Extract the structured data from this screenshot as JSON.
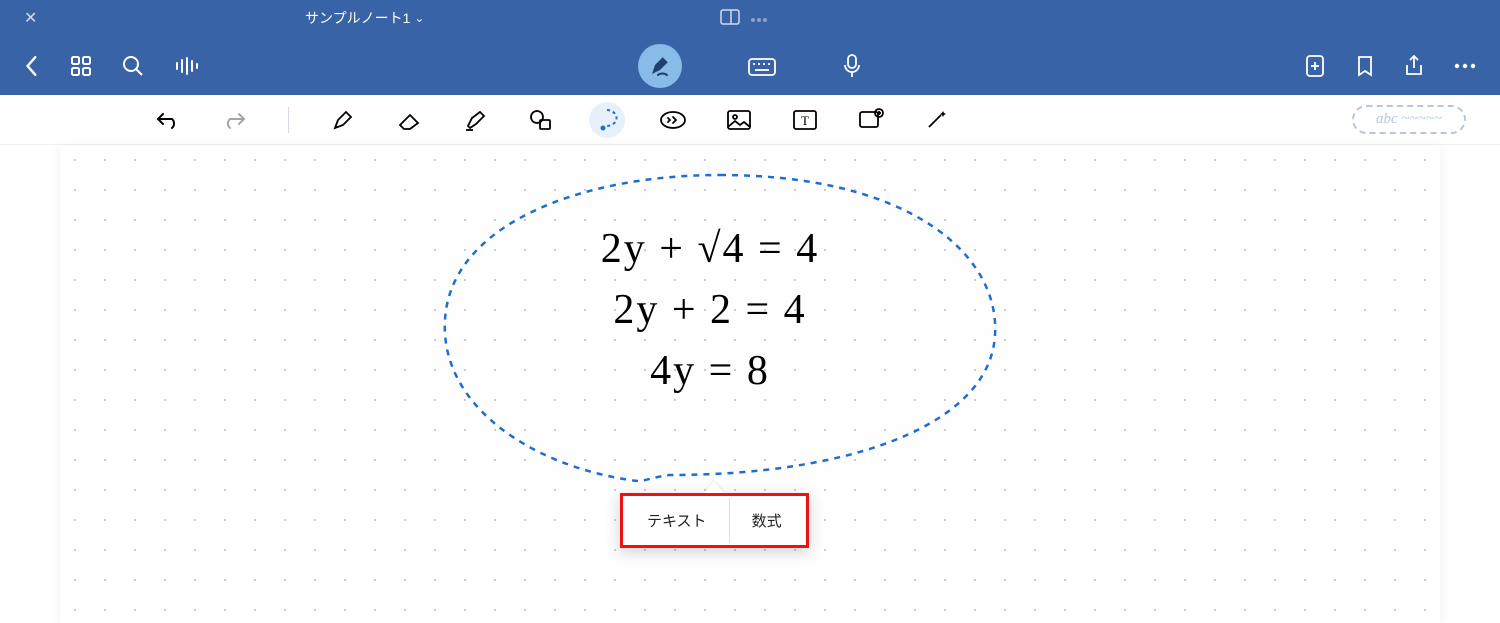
{
  "header": {
    "close_label": "✕",
    "title": "サンプルノート1",
    "title_chevron": "⌄"
  },
  "toolbar": {
    "ocr_placeholder": "abc ~~~~~"
  },
  "handwriting": {
    "line1": "2y + √4  = 4",
    "line2": "2y + 2  = 4",
    "line3": "4y = 8"
  },
  "popup": {
    "text_label": "テキスト",
    "formula_label": "数式"
  }
}
